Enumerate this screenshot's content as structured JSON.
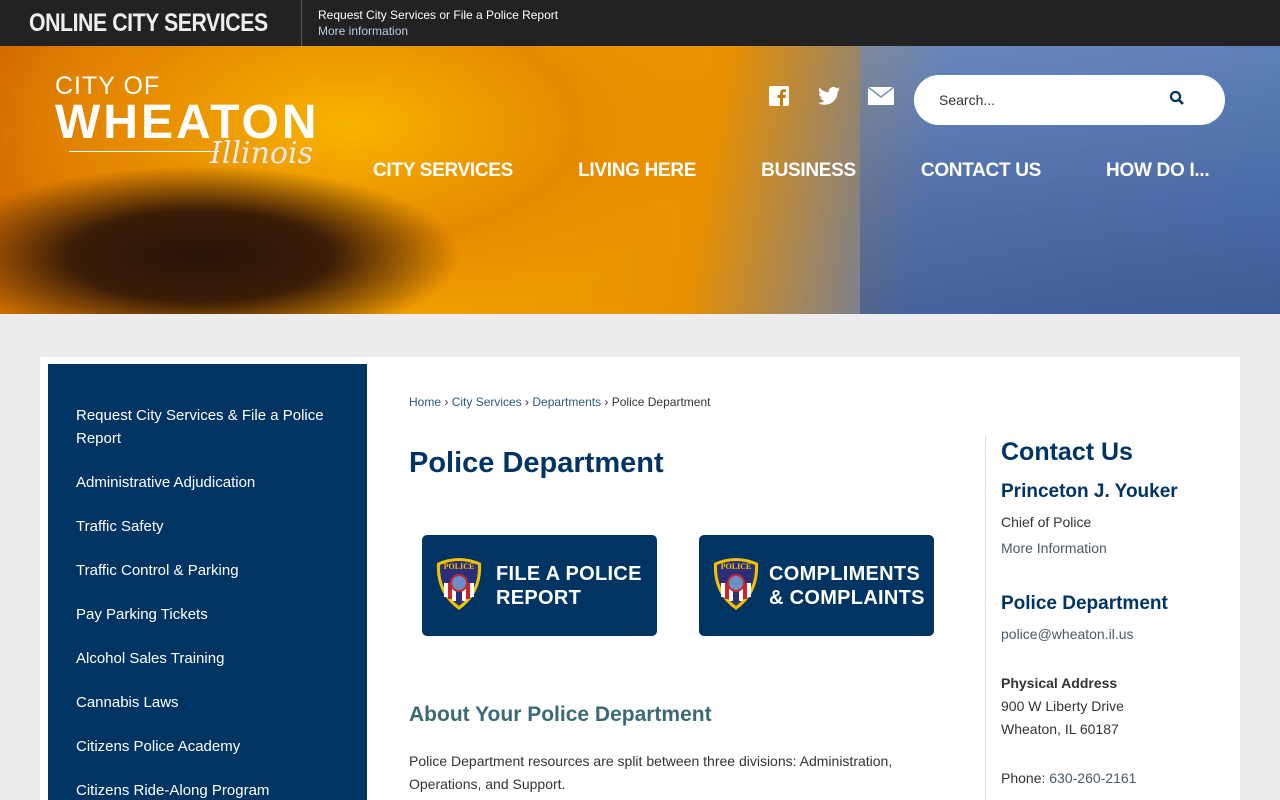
{
  "topbar": {
    "title": "ONLINE CITY SERVICES",
    "line1": "Request City Services or File a Police Report",
    "line2": "More information"
  },
  "logo": {
    "line1": "CITY OF",
    "line2": "WHEATON",
    "line3": "Illinois"
  },
  "social": [
    "facebook-icon",
    "twitter-icon",
    "email-icon"
  ],
  "search": {
    "placeholder": "Search..."
  },
  "nav": [
    "CITY SERVICES",
    "LIVING HERE",
    "BUSINESS",
    "CONTACT US",
    "HOW DO I..."
  ],
  "sidebar": [
    "Request City Services & File a Police Report",
    "Administrative Adjudication",
    "Traffic Safety",
    "Traffic Control & Parking",
    "Pay Parking Tickets",
    "Alcohol Sales Training",
    "Cannabis Laws",
    "Citizens Police Academy",
    "Citizens Ride-Along Program"
  ],
  "breadcrumb": [
    "Home",
    "City Services",
    "Departments",
    "Police Department"
  ],
  "page_title": "Police Department",
  "buttons": [
    {
      "line1": "FILE A POLICE",
      "line2": "REPORT",
      "badge": "POLICE"
    },
    {
      "line1": "COMPLIMENTS",
      "line2": "& COMPLAINTS",
      "badge": "POLICE"
    }
  ],
  "about": {
    "heading": "About Your Police Department",
    "text": "Police Department resources are split between three divisions: Administration, Operations, and Support."
  },
  "contact": {
    "heading": "Contact Us",
    "name": "Princeton J. Youker",
    "role": "Chief of Police",
    "more": "More Information",
    "dept": "Police Department",
    "email": "police@wheaton.il.us",
    "addr_label": "Physical Address",
    "addr1": "900 W Liberty Drive",
    "addr2": "Wheaton, IL 60187",
    "phone_label": "Phone: ",
    "phone": "630-260-2161"
  },
  "colors": {
    "navy": "#003462",
    "topbar": "#222222"
  }
}
